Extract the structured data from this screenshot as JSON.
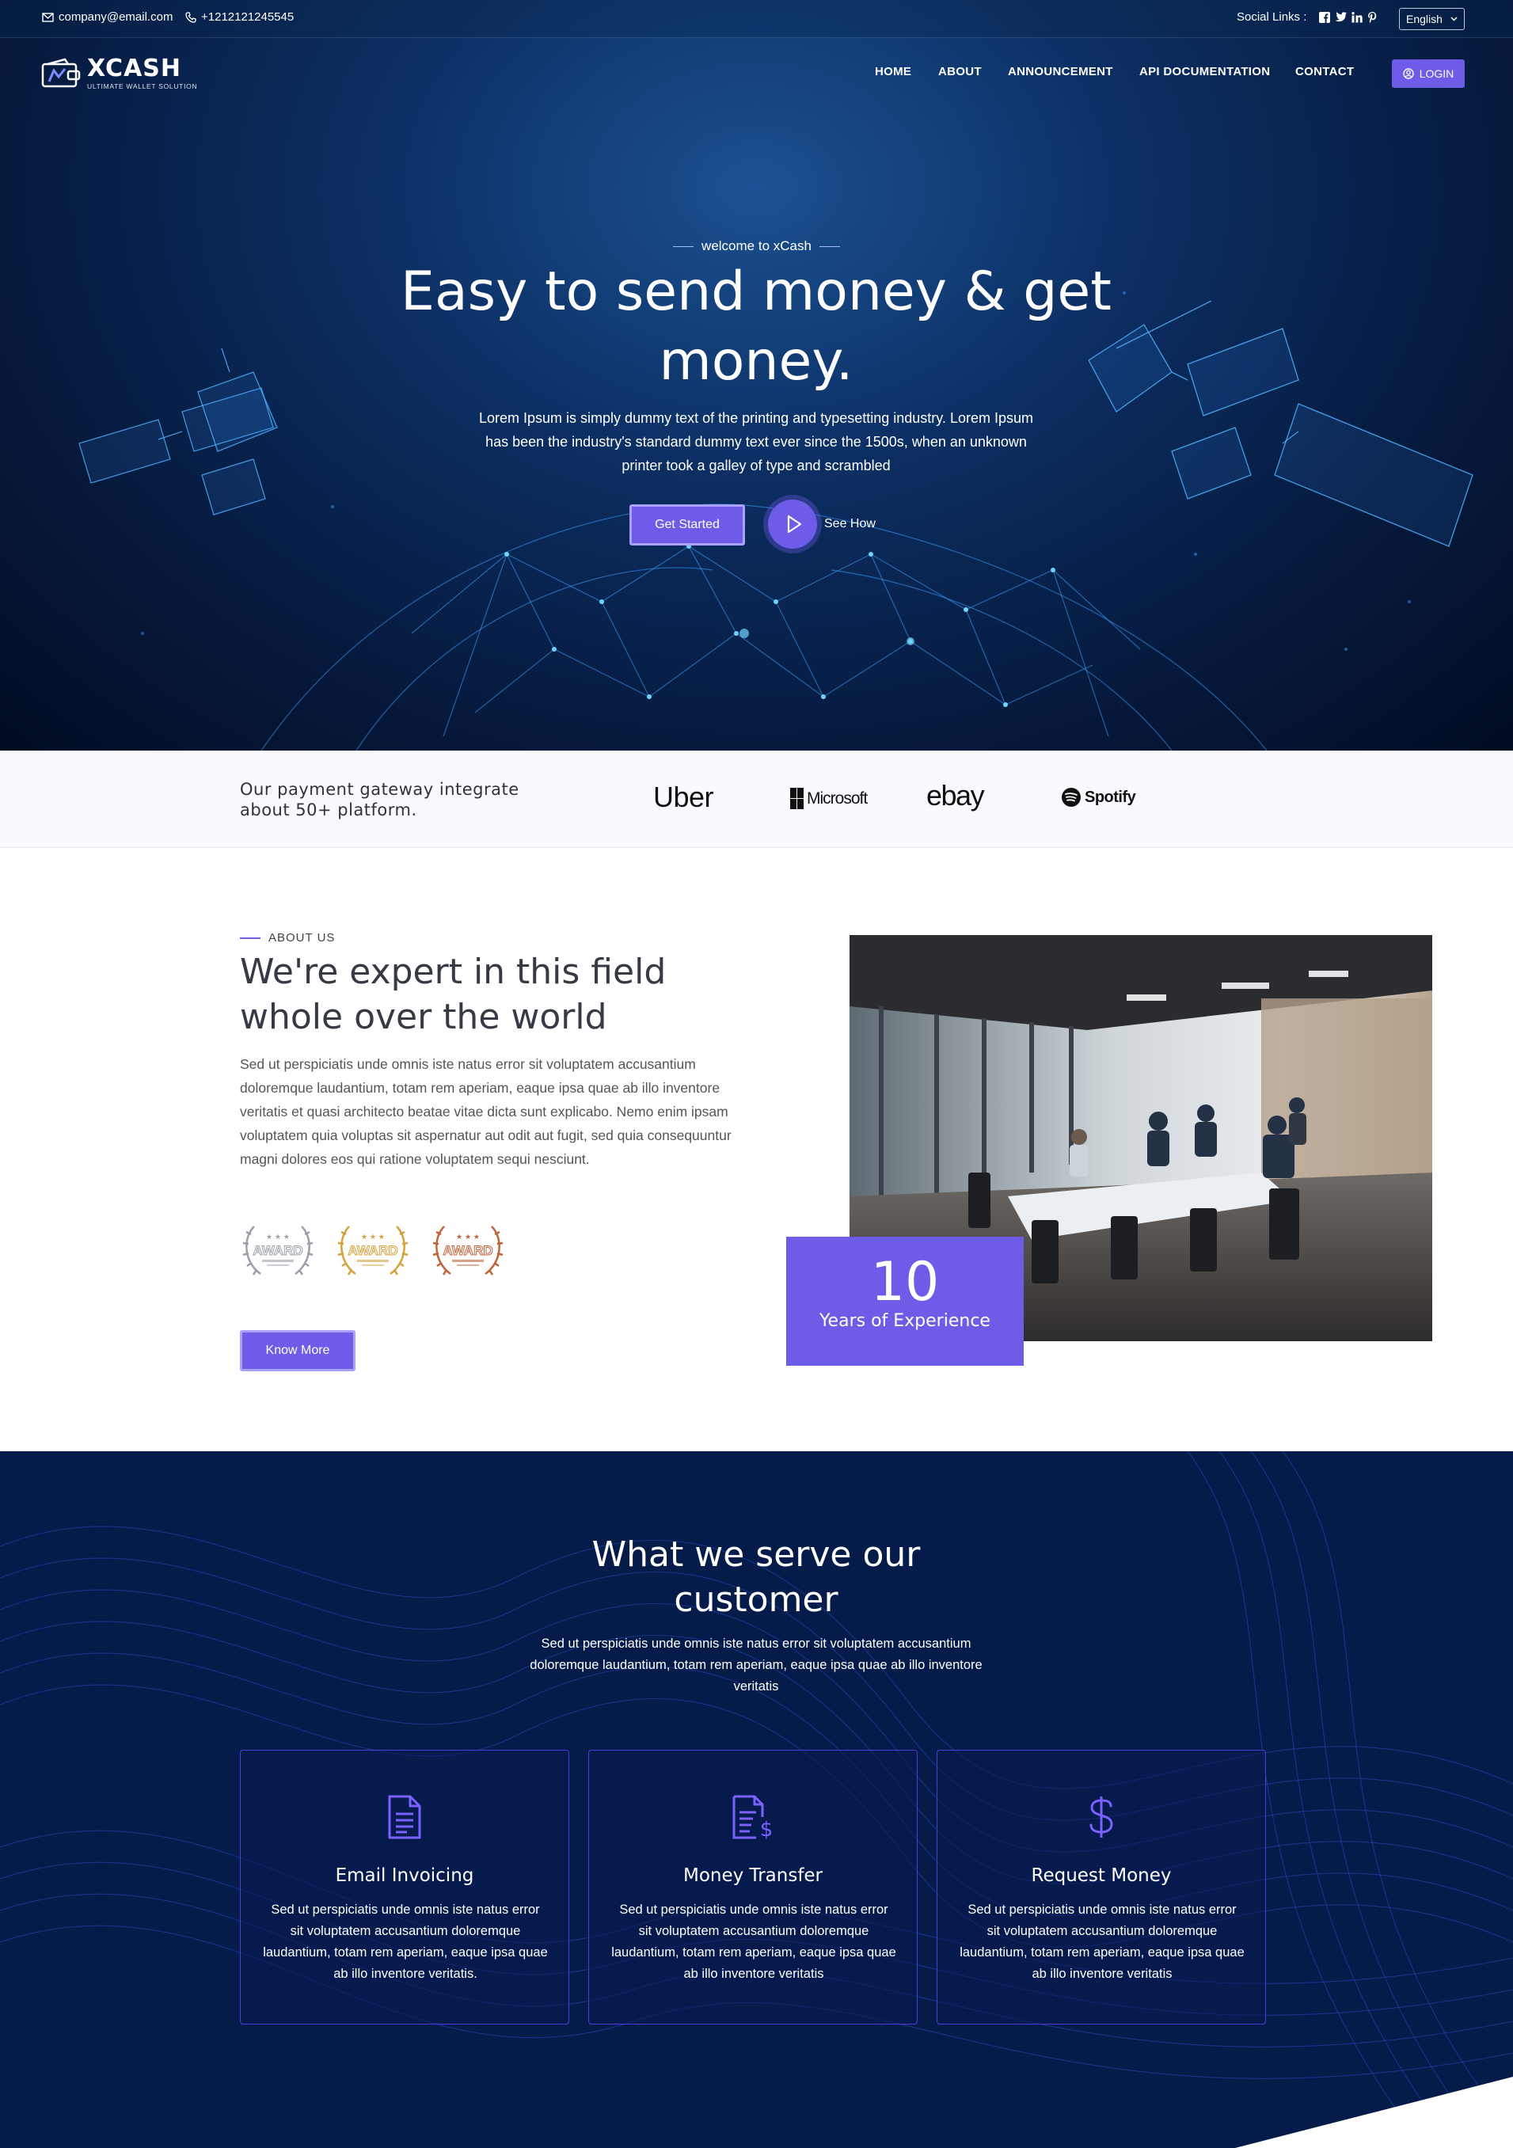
{
  "topbar": {
    "email": "company@email.com",
    "phone": "+1212121245545",
    "social_label": "Social Links :",
    "social_icons": [
      "facebook-icon",
      "twitter-icon",
      "linkedin-icon",
      "pinterest-icon"
    ],
    "language": "English"
  },
  "header": {
    "logo_text": "XCASH",
    "logo_tagline": "ULTIMATE WALLET SOLUTION",
    "nav": [
      "HOME",
      "ABOUT",
      "ANNOUNCEMENT",
      "API DOCUMENTATION",
      "CONTACT"
    ],
    "login_label": "LOGIN"
  },
  "hero": {
    "eyebrow": "welcome to xCash",
    "title": "Easy to send money & get money.",
    "text": "Lorem Ipsum is simply dummy text of the printing and typesetting industry. Lorem Ipsum has been the industry's standard dummy text ever since the 1500s, when an unknown printer took a galley of type and scrambled",
    "cta_primary": "Get Started",
    "cta_secondary": "See How"
  },
  "partners": {
    "text": "Our payment gateway integrate about 50+ platform.",
    "brands": [
      "Uber",
      "Microsoft",
      "ebay",
      "Spotify"
    ]
  },
  "about": {
    "eyebrow": "ABOUT US",
    "title": "We're expert in this field whole over the world",
    "text": "Sed ut perspiciatis unde omnis iste natus error sit voluptatem accusantium doloremque laudantium, totam rem aperiam, eaque ipsa quae ab illo inventore veritatis et quasi architecto beatae vitae dicta sunt explicabo. Nemo enim ipsam voluptatem quia voluptas sit aspernatur aut odit aut fugit, sed quia consequuntur magni dolores eos qui ratione voluptatem sequi nesciunt.",
    "awards": [
      {
        "label": "AWARD",
        "color": "#9aa0a8"
      },
      {
        "label": "AWARD",
        "color": "#d4a23a"
      },
      {
        "label": "AWARD",
        "color": "#c0623a"
      }
    ],
    "button": "Know More",
    "experience_number": "10",
    "experience_label": "Years of Experience"
  },
  "services": {
    "title": "What we serve our customer",
    "text": "Sed ut perspiciatis unde omnis iste natus error sit voluptatem accusantium doloremque laudantium, totam rem aperiam, eaque ipsa quae ab illo inventore veritatis",
    "cards": [
      {
        "icon": "invoice-icon",
        "title": "Email Invoicing",
        "text": "Sed ut perspiciatis unde omnis iste natus error sit voluptatem accusantium doloremque laudantium, totam rem aperiam, eaque ipsa quae ab illo inventore veritatis."
      },
      {
        "icon": "money-transfer-icon",
        "title": "Money Transfer",
        "text": "Sed ut perspiciatis unde omnis iste natus error sit voluptatem accusantium doloremque laudantium, totam rem aperiam, eaque ipsa quae ab illo inventore veritatis"
      },
      {
        "icon": "dollar-icon",
        "title": "Request Money",
        "text": "Sed ut perspiciatis unde omnis iste natus error sit voluptatem accusantium doloremque laudantium, totam rem aperiam, eaque ipsa quae ab illo inventore veritatis"
      }
    ]
  },
  "colors": {
    "accent": "#6c5ce7",
    "hero_dark": "#061a3e",
    "services_bg": "#051c4a"
  }
}
